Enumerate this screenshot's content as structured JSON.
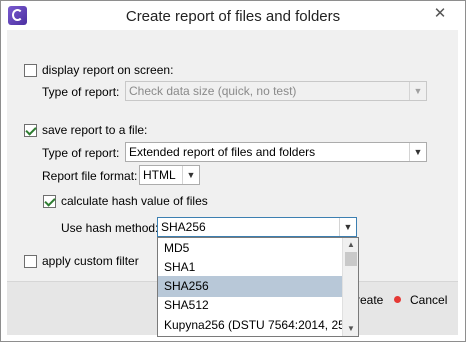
{
  "window": {
    "title": "Create report of files and folders",
    "close_glyph": "✕"
  },
  "display_screen": {
    "checkbox_label": "display report on screen:",
    "checked": false,
    "type_label": "Type of report:",
    "type_value": "Check data size (quick, no test)"
  },
  "save_file": {
    "checkbox_label": "save report to a file:",
    "checked": true,
    "type_label": "Type of report:",
    "type_value": "Extended report of files and folders",
    "format_label": "Report file format:",
    "format_value": "HTML"
  },
  "hash": {
    "checkbox_label": "calculate hash value of files",
    "checked": true,
    "method_label": "Use hash method:",
    "method_value": "SHA256",
    "options": [
      "MD5",
      "SHA1",
      "SHA256",
      "SHA512",
      "Kupyna256 (DSTU 7564:2014, 25..."
    ],
    "selected_option": "SHA256"
  },
  "filter": {
    "checkbox_label": "apply custom filter",
    "checked": false
  },
  "buttons": {
    "create_label": "reate",
    "cancel_label": "Cancel"
  },
  "icons": {
    "app": "app-logo-icon",
    "combo_arrow": "chevron-down-icon",
    "scroll_up": "scroll-up-icon",
    "scroll_down": "scroll-down-icon",
    "cancel": "red-dot-icon"
  },
  "colors": {
    "selected_item_bg": "#b8c8d8",
    "check_mark": "#2f7d32",
    "cancel_dot": "#e53935"
  }
}
